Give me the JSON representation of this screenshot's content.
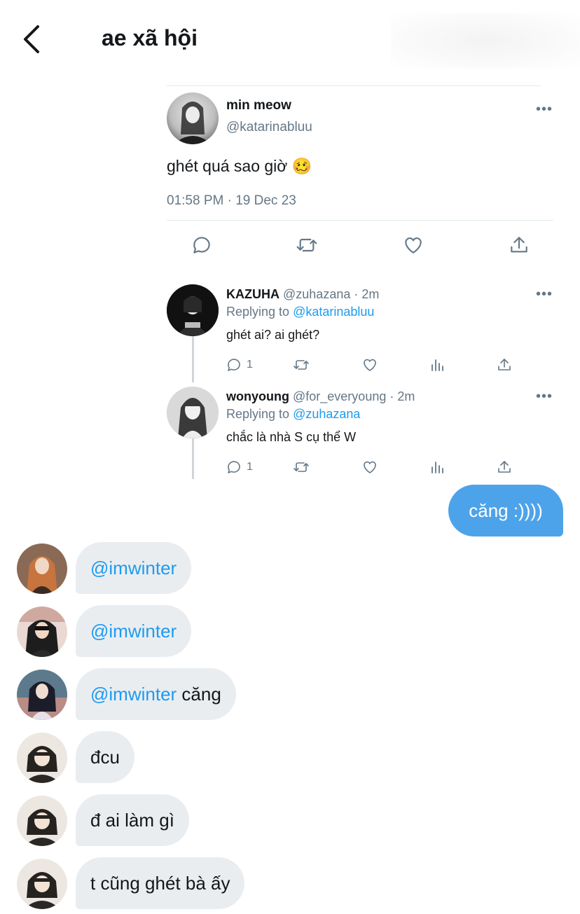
{
  "header": {
    "title": "ae xã hội",
    "back_icon": "chevron-left-icon"
  },
  "shared_tweet": {
    "author_name": "min meow",
    "author_handle": "@katarinabluu",
    "text": "ghét quá sao giờ 🥴",
    "timestamp": "01:58 PM · 19 Dec 23",
    "more_icon": "more-horizontal-icon",
    "actions": [
      "reply-icon",
      "retweet-icon",
      "like-icon",
      "share-icon"
    ]
  },
  "replies": [
    {
      "name": "KAZUHA",
      "handle": "@zuhazana",
      "time": "2m",
      "replying_label": "Replying to",
      "replying_to": "@katarinabluu",
      "text": "ghét ai? ai ghét?",
      "reply_count": "1"
    },
    {
      "name": "wonyoung",
      "handle": "@for_everyoung",
      "time": "2m",
      "replying_label": "Replying to",
      "replying_to": "@zuhazana",
      "text": "chắc là nhà S cụ thể W",
      "reply_count": "1"
    }
  ],
  "outgoing_message": {
    "text": "căng :))))"
  },
  "messages": [
    {
      "mention": "@imwinter",
      "text": ""
    },
    {
      "mention": "@imwinter",
      "text": ""
    },
    {
      "mention": "@imwinter",
      "text": " căng"
    },
    {
      "mention": "",
      "text": "đcu"
    },
    {
      "mention": "",
      "text": "đ ai làm gì"
    },
    {
      "mention": "",
      "text": "t cũng ghét bà ấy"
    }
  ],
  "colors": {
    "accent": "#1d9bf0",
    "outgoing_bubble": "#4da3ea",
    "incoming_bubble": "#eaedf0",
    "muted_text": "#657786"
  }
}
